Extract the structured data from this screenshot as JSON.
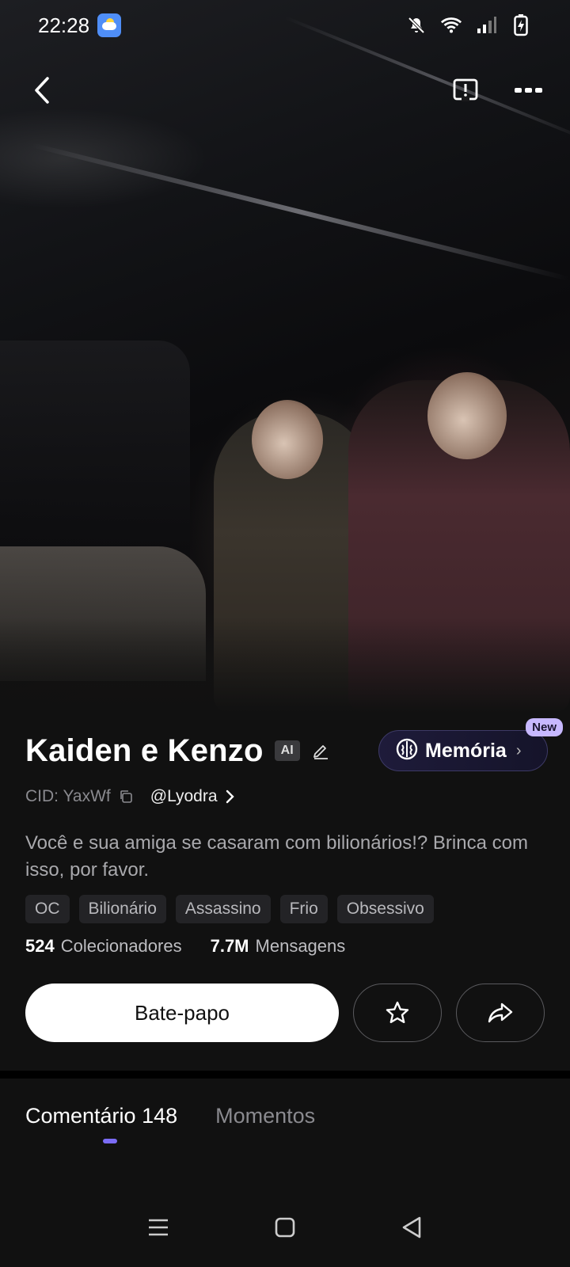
{
  "status": {
    "time": "22:28",
    "icons": [
      "weather-icon",
      "mute-icon",
      "wifi-icon",
      "signal-icon",
      "battery-charging-icon"
    ]
  },
  "nav": {
    "back_icon": "back-icon",
    "download_icon": "download-icon",
    "more_icon": "more-icon"
  },
  "character": {
    "name": "Kaiden e Kenzo",
    "ai_badge": "AI",
    "cid": "CID: YaxWf",
    "author": "@Lyodra",
    "description": "Você e sua amiga se casaram com bilionários!? Brinca com isso, por favor.",
    "tags": [
      "OC",
      "Bilionário",
      "Assassino",
      "Frio",
      "Obsessivo"
    ]
  },
  "memory": {
    "label": "Memória",
    "badge": "New"
  },
  "stats": {
    "collectors_count": "524",
    "collectors_label": "Colecionadores",
    "messages_count": "7.7M",
    "messages_label": "Mensagens"
  },
  "actions": {
    "chat_label": "Bate-papo"
  },
  "tabs": [
    {
      "label": "Comentário 148",
      "active": true
    },
    {
      "label": "Momentos",
      "active": false
    }
  ],
  "colors": {
    "accent": "#7b6cf6",
    "memory_border": "#3d3a66",
    "new_badge": "#c7b8ff"
  }
}
